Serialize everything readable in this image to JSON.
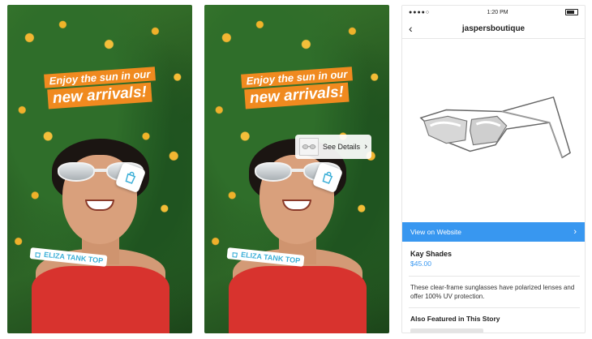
{
  "story_left": {
    "caption_line1": "Enjoy the sun in our",
    "caption_line2": "new arrivals!",
    "product_tag_label": "ELIZA TANK TOP",
    "icon_sticker": "shopping-bag-icon",
    "colors": {
      "caption_bg": "#f08a1f",
      "tag_text": "#3eb0d8"
    }
  },
  "story_right": {
    "caption_line1": "Enjoy the sun in our",
    "caption_line2": "new arrivals!",
    "product_tag_label": "ELIZA TANK TOP",
    "see_details_label": "See Details",
    "icon_sticker": "shopping-bag-icon"
  },
  "product_view": {
    "status_bar": {
      "signal": "●●●●○",
      "time": "1:20 PM"
    },
    "header_title": "jaspersboutique",
    "view_on_website_label": "View on Website",
    "product_name": "Kay Shades",
    "product_price": "$45.00",
    "description": "These clear-frame sunglasses have polarized lenses and offer 100% UV protection.",
    "also_featured_heading": "Also Featured in This Story",
    "colors": {
      "accent": "#3897f0"
    }
  }
}
